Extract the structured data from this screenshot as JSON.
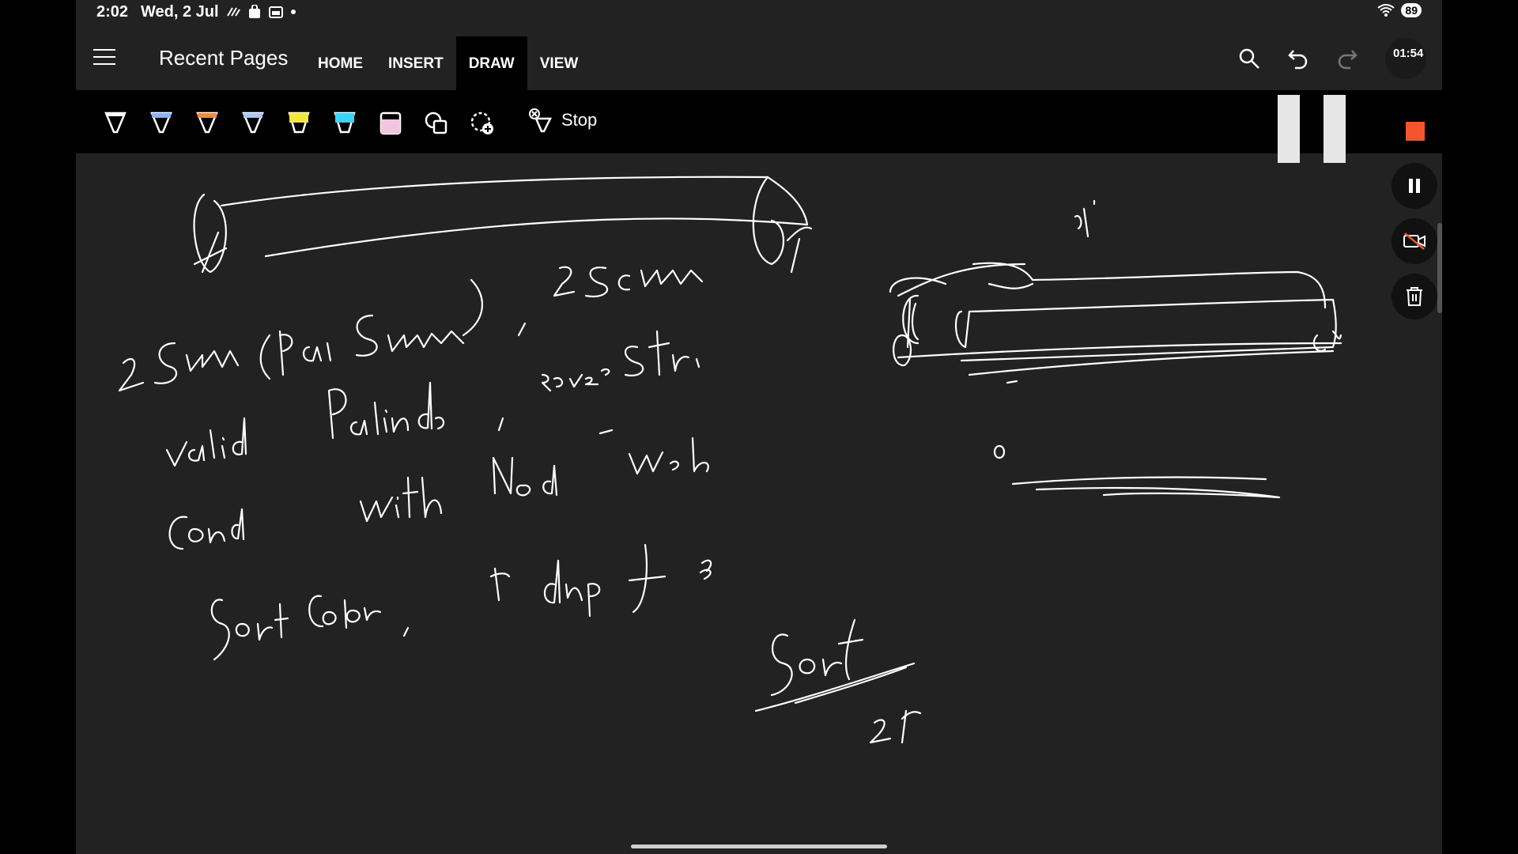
{
  "status_bar": {
    "time": "2:02",
    "date": "Wed, 2 Jul",
    "battery": "89"
  },
  "app_bar": {
    "title": "Recent Pages",
    "tabs": [
      {
        "label": "HOME",
        "active": false
      },
      {
        "label": "INSERT",
        "active": false
      },
      {
        "label": "DRAW",
        "active": true
      },
      {
        "label": "VIEW",
        "active": false
      }
    ],
    "timer": "01:54"
  },
  "toolbar": {
    "stop_label": "Stop",
    "pens": [
      {
        "name": "white-pen",
        "color": "#ffffff"
      },
      {
        "name": "blue-pen",
        "color": "#8ab4f8"
      },
      {
        "name": "orange-pen",
        "color": "#f28b40"
      },
      {
        "name": "light-blue-pen",
        "color": "#a8c7fa"
      },
      {
        "name": "yellow-highlighter",
        "color": "#f5e63a"
      },
      {
        "name": "cyan-highlighter",
        "color": "#3ad5f5"
      },
      {
        "name": "pink-highlighter",
        "color": "#f2c6de"
      }
    ]
  },
  "colors": {
    "screen_bg": "#222222",
    "toolbar_bg": "#000000",
    "record_stop": "#f4552c",
    "ink": "#ffffff"
  },
  "canvas": {
    "ink_text": [
      "2 Sum (Pai Sum)",
      "2Sum",
      "valid Palindo",
      "rover Str",
      "Cond",
      "with Mod",
      "Web",
      "Sort Color",
      "dup",
      "Sort",
      "21",
      "gr"
    ]
  }
}
